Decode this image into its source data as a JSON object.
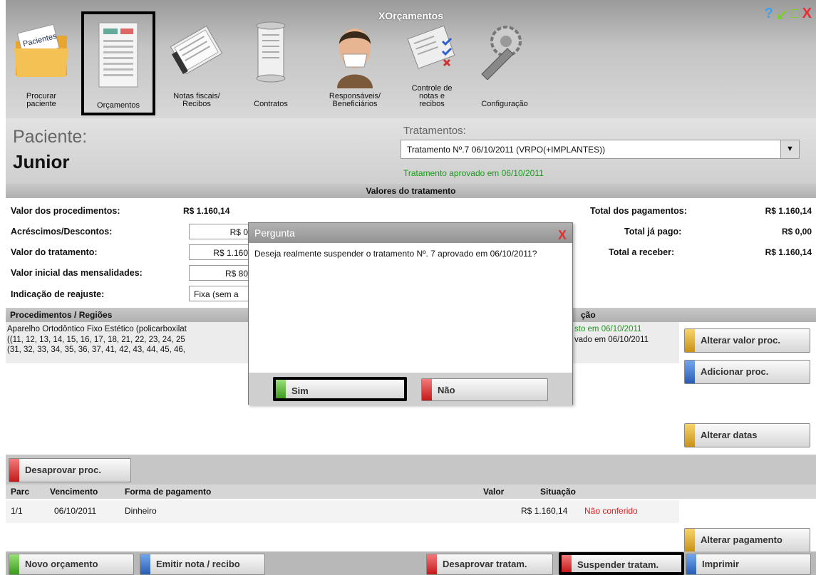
{
  "window": {
    "title": "XOrçamentos",
    "controls": [
      "?",
      "↙",
      "□",
      "X"
    ]
  },
  "toolbar": [
    {
      "label": "Procurar\npaciente",
      "icon_text": "Pacientes"
    },
    {
      "label": "Orçamentos"
    },
    {
      "label": "Notas fiscais/\nRecibos"
    },
    {
      "label": "Contratos"
    },
    {
      "label": "Responsáveis/\nBeneficiários"
    },
    {
      "label": "Controle de\nnotas e\nrecibos"
    },
    {
      "label": "Configuração"
    }
  ],
  "patient": {
    "label": "Paciente:",
    "name": "Junior"
  },
  "treatments": {
    "label": "Tratamentos:",
    "selected": "Tratamento Nº.7 06/10/2011 (VRPO(+IMPLANTES))",
    "status": "Tratamento aprovado em 06/10/2011"
  },
  "values": {
    "header": "Valores do tratamento",
    "proc_label": "Valor dos procedimentos:",
    "proc_value": "R$ 1.160,14",
    "acresc_label": "Acréscimos/Descontos:",
    "acresc_value": "R$ 0",
    "trat_label": "Valor do tratamento:",
    "trat_value": "R$ 1.160",
    "mens_label": "Valor inicial das mensalidades:",
    "mens_value": "R$ 80",
    "reaj_label": "Indicação de reajuste:",
    "reaj_value": "Fixa (sem a",
    "total_pag_label": "Total dos pagamentos:",
    "total_pag_value": "R$ 1.160,14",
    "pago_label": "Total já pago:",
    "pago_value": "R$ 0,00",
    "receber_label": "Total a receber:",
    "receber_value": "R$ 1.160,14"
  },
  "procedures": {
    "header": "Procedimentos / Regiões",
    "header_right": "ção",
    "lines": [
      "Aparelho Ortodôntico Fixo Estético (policarboxilat",
      "((11, 12, 13, 14, 15, 16, 17, 18, 21, 22, 23, 24, 25",
      "(31, 32, 33, 34, 35, 36, 37, 41, 42, 43, 44, 45, 46,"
    ],
    "status_lines": [
      "sto em 06/10/2011",
      "vado em 06/10/2011"
    ]
  },
  "side_buttons": {
    "alter_val": "Alterar valor proc.",
    "add_proc": "Adicionar proc.",
    "alter_dates": "Alterar datas"
  },
  "disapprove_proc": "Desaprovar proc.",
  "payments": {
    "cols": {
      "parc": "Parc",
      "venc": "Vencimento",
      "forma": "Forma de pagamento",
      "valor": "Valor",
      "sit": "Situação"
    },
    "row": {
      "parc": "1/1",
      "venc": "06/10/2011",
      "forma": "Dinheiro",
      "valor": "R$ 1.160,14",
      "sit": "Não conferido"
    },
    "alter_btn": "Alterar pagamento"
  },
  "bottom": {
    "novo": "Novo orçamento",
    "emitir": "Emitir nota / recibo",
    "desaprovar": "Desaprovar tratam.",
    "suspender": "Suspender tratam.",
    "imprimir": "Imprimir"
  },
  "dialog": {
    "title": "Pergunta",
    "close": "X",
    "message": "Deseja realmente suspender o tratamento Nº. 7 aprovado em 06/10/2011?",
    "yes": "Sim",
    "no": "Não"
  },
  "colors": {
    "green_status": "#1a9a1a",
    "red_status": "#e02020"
  }
}
